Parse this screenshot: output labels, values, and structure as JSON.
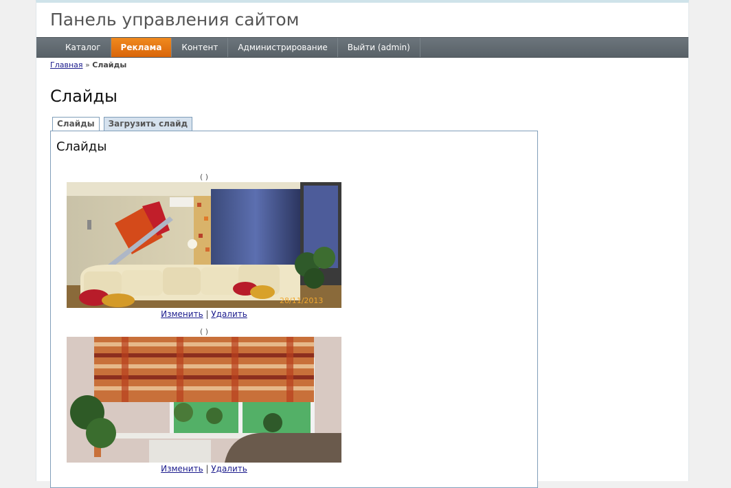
{
  "header": {
    "title": "Панель управления сайтом"
  },
  "nav": {
    "items": [
      {
        "label": "Каталог",
        "active": false
      },
      {
        "label": "Реклама",
        "active": true
      },
      {
        "label": "Контент",
        "active": false
      },
      {
        "label": "Администрирование",
        "active": false
      },
      {
        "label": "Выйти (admin)",
        "active": false
      }
    ]
  },
  "breadcrumb": {
    "home": "Главная",
    "separator": "»",
    "current": "Слайды"
  },
  "page": {
    "title": "Слайды"
  },
  "tabs": [
    {
      "label": "Слайды",
      "active": true
    },
    {
      "label": "Загрузить слайд",
      "active": false
    }
  ],
  "panel": {
    "title": "Слайды",
    "slides": [
      {
        "caption": "( )",
        "image": "living-room-photo",
        "date_stamp": "28/11/2013",
        "edit_label": "Изменить",
        "separator": "|",
        "delete_label": "Удалить"
      },
      {
        "caption": "( )",
        "image": "window-blinds-photo",
        "edit_label": "Изменить",
        "separator": "|",
        "delete_label": "Удалить"
      }
    ]
  }
}
